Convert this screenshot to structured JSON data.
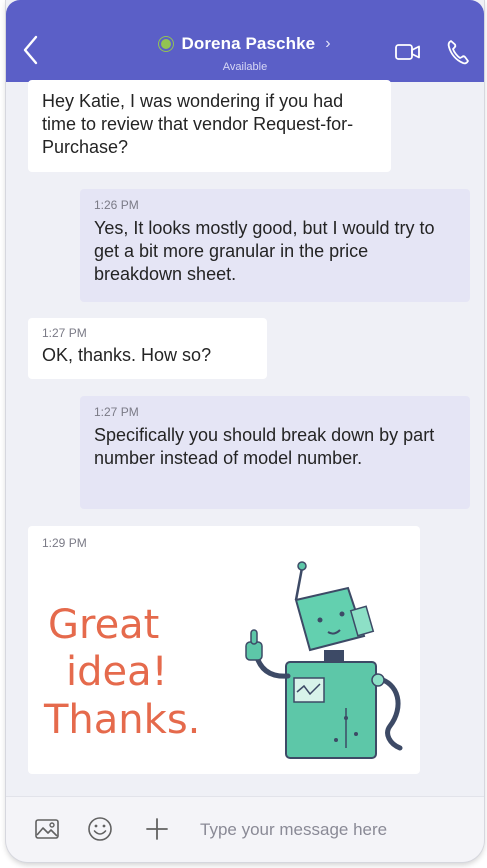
{
  "header": {
    "contact_name": "Dorena Paschke",
    "status": "Available",
    "accent_color": "#5b5fc7",
    "presence_color": "#92c353",
    "icons": [
      "back-chevron-icon",
      "chevron-right-icon",
      "video-camera-icon",
      "phone-icon"
    ]
  },
  "messages": [
    {
      "from": "contact",
      "time": "",
      "text": "Hey Katie, I was wondering if you had time to review that vendor Request-for-Purchase?"
    },
    {
      "from": "me",
      "time": "1:26 PM",
      "text": "Yes, It looks mostly good, but I would try to get a bit more granular in the price breakdown sheet."
    },
    {
      "from": "contact",
      "time": "1:27 PM",
      "text": "OK, thanks. How so?"
    },
    {
      "from": "me",
      "time": "1:27 PM",
      "text": "Specifically you should break down by part number instead of model number."
    },
    {
      "from": "contact",
      "time": "1:29 PM",
      "sticker": {
        "line1": "Great",
        "line2": "idea!",
        "line3": "Thanks.",
        "image": "robot-thumbs-up"
      }
    }
  ],
  "composer": {
    "placeholder": "Type your message here",
    "value": "",
    "icons": [
      "image-icon",
      "emoji-icon",
      "plus-icon"
    ]
  }
}
